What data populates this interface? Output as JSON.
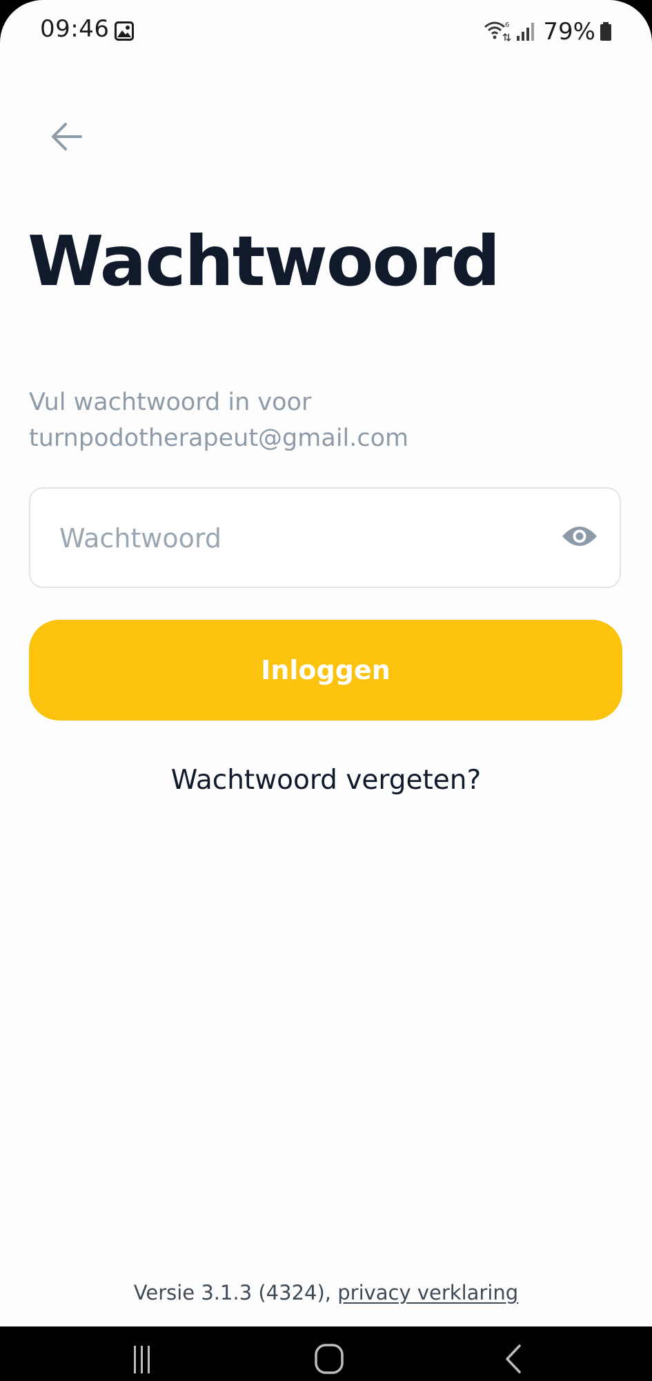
{
  "status_bar": {
    "time": "09:46",
    "battery": "79%",
    "icons": [
      "image-icon",
      "wifi-icon",
      "signal-icon",
      "battery-icon"
    ]
  },
  "header": {
    "back_icon": "arrow-left-icon"
  },
  "main": {
    "title": "Wachtwoord",
    "subtitle": "Vul wachtwoord in voor turnpodotherapeut@gmail.com",
    "password_field": {
      "value": "",
      "placeholder": "Wachtwoord",
      "toggle_icon": "eye-icon"
    },
    "login_label": "Inloggen",
    "forgot_label": "Wachtwoord vergeten?"
  },
  "footer": {
    "version": "Versie 3.1.3 (4324),",
    "privacy_label": "privacy verklaring"
  },
  "nav_bar": {
    "buttons": [
      "recents-icon",
      "home-icon",
      "back-icon"
    ]
  },
  "colors": {
    "accent": "#fbc20e",
    "title": "#101a2b",
    "muted": "#8d9aa8"
  }
}
